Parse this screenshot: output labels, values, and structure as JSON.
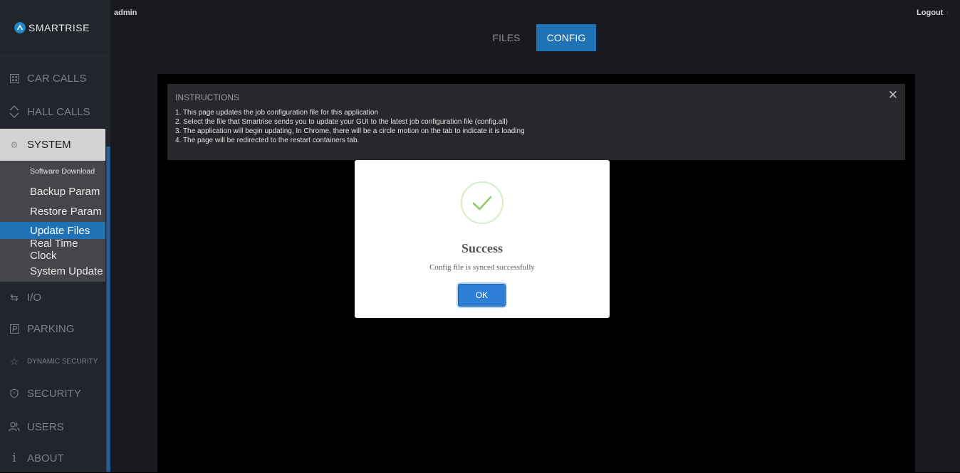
{
  "header": {
    "user": "admin",
    "logout_label": "Logout"
  },
  "brand": {
    "name": "SMARTRISE",
    "accent_color": "#1e88c9"
  },
  "sidebar": {
    "items": [
      {
        "label": "CAR CALLS",
        "icon": "car-calls-icon"
      },
      {
        "label": "HALL CALLS",
        "icon": "hall-calls-icon"
      },
      {
        "label": "SYSTEM",
        "icon": "gear-icon"
      },
      {
        "label": "I/O",
        "icon": "io-arrows-icon"
      },
      {
        "label": "PARKING",
        "icon": "parking-icon"
      },
      {
        "label": "DYNAMIC SECURITY",
        "icon": "star-icon"
      },
      {
        "label": "SECURITY",
        "icon": "shield-icon"
      },
      {
        "label": "USERS",
        "icon": "users-icon"
      },
      {
        "label": "ABOUT",
        "icon": "info-icon"
      }
    ],
    "submenu": [
      {
        "label": "Software Download"
      },
      {
        "label": "Backup Param"
      },
      {
        "label": "Restore Param"
      },
      {
        "label": "Update Files"
      },
      {
        "label": "Real Time Clock"
      },
      {
        "label": "System Update"
      }
    ]
  },
  "tabs": [
    {
      "label": "FILES"
    },
    {
      "label": "CONFIG"
    }
  ],
  "instructions": {
    "title": "INSTRUCTIONS",
    "lines": [
      "1. This page updates the job configuration file for this application",
      "2. Select the file that Smartrise sends you to update your GUI to the latest job configuration file (config.all)",
      "3. The application will begin updating, In Chrome, there will be a circle motion on the tab to indicate it is loading",
      "4. The page will be redirected to the restart containers tab."
    ]
  },
  "modal": {
    "title": "Success",
    "message": "Config file is synced successfully",
    "ok_label": "OK",
    "icon": "success-check-icon",
    "check_color": "#8fce6b"
  }
}
